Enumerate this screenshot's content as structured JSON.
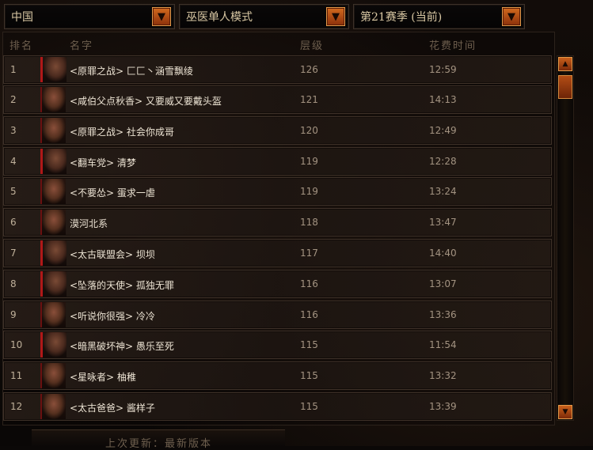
{
  "filters": {
    "region": "中国",
    "mode": "巫医单人模式",
    "season": "第21赛季 (当前)"
  },
  "columns": {
    "rank": "排名",
    "name": "名字",
    "level": "层级",
    "time": "花费时间"
  },
  "rows": [
    {
      "rank": "1",
      "name": "<原罪之战> 匚匚丶涵雪飘绫",
      "level": "126",
      "time": "12:59"
    },
    {
      "rank": "2",
      "name": "<咸伯父点秋香> 又要威又要戴头盔",
      "level": "121",
      "time": "14:13"
    },
    {
      "rank": "3",
      "name": "<原罪之战> 社会你成哥",
      "level": "120",
      "time": "12:49"
    },
    {
      "rank": "4",
      "name": "<翻车党> 清梦",
      "level": "119",
      "time": "12:28"
    },
    {
      "rank": "5",
      "name": "<不要怂> 蛋求一虐",
      "level": "119",
      "time": "13:24"
    },
    {
      "rank": "6",
      "name": "漠河北系",
      "level": "118",
      "time": "13:47"
    },
    {
      "rank": "7",
      "name": "<太古联盟会> 坝坝",
      "level": "117",
      "time": "14:40"
    },
    {
      "rank": "8",
      "name": "<坠落的天使> 孤独无罪",
      "level": "116",
      "time": "13:07"
    },
    {
      "rank": "9",
      "name": "<听说你很强> 冷冷",
      "level": "116",
      "time": "13:36"
    },
    {
      "rank": "10",
      "name": "<暗黑破坏神> 愚乐至死",
      "level": "115",
      "time": "11:54"
    },
    {
      "rank": "11",
      "name": "<星咏者> 柚稚",
      "level": "115",
      "time": "13:32"
    },
    {
      "rank": "12",
      "name": "<太古爸爸> 酱样子",
      "level": "115",
      "time": "13:39"
    }
  ],
  "footer": "上次更新：最新版本",
  "icons": {
    "dropdown": "chevron-down-icon",
    "scroll_up": "chevron-up-icon",
    "scroll_down": "chevron-down-icon",
    "avatar": "witch-doctor-portrait"
  },
  "colors": {
    "accent": "#c9601c",
    "text": "#ece3d3",
    "muted": "#a39381"
  }
}
